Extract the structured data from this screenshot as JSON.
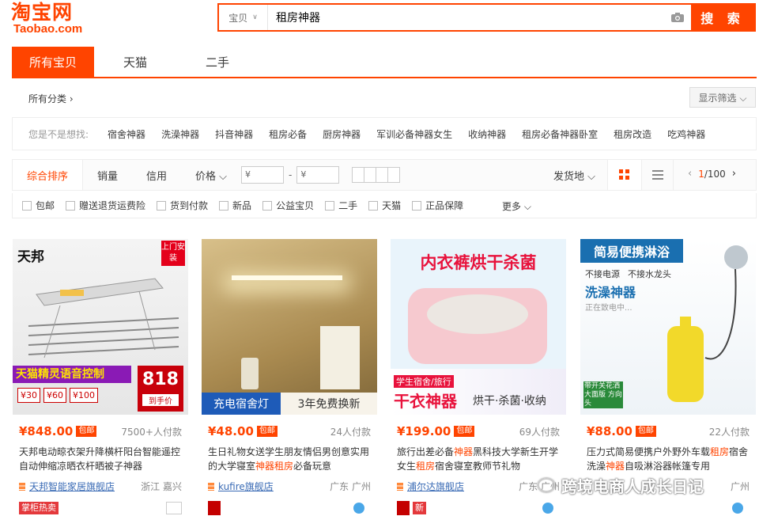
{
  "header": {
    "logo_cn": "淘宝网",
    "logo_en": "Taobao.com",
    "search_category": "宝贝",
    "search_query": "租房神器",
    "search_button": "搜 索"
  },
  "tabs": [
    "所有宝贝",
    "天猫",
    "二手"
  ],
  "all_categories": "所有分类 ›",
  "filter_button": "显示筛选 ⌵",
  "suggestions": {
    "label": "您是不是想找:",
    "items": [
      "宿舍神器",
      "洗澡神器",
      "抖音神器",
      "租房必备",
      "厨房神器",
      "军训必备神器女生",
      "收纳神器",
      "租房必备神器卧室",
      "租房改造",
      "吃鸡神器"
    ]
  },
  "sortbar": {
    "sorts": [
      "综合排序",
      "销量",
      "信用",
      "价格 ⌵"
    ],
    "price_min_placeholder": "¥",
    "price_max_placeholder": "¥",
    "price_dash": "-",
    "ship_from": "发货地 ⌵",
    "page_current": "1",
    "page_total": "/100"
  },
  "checks": [
    "包邮",
    "赠送退货运费险",
    "货到付款",
    "新品",
    "公益宝贝",
    "二手",
    "天猫",
    "正品保障"
  ],
  "more": "更多 ⌵",
  "items": [
    {
      "price": "¥848.00",
      "tag": "包邮",
      "deals": "7500+人付款",
      "title": "天邦电动晾衣架升降横杆阳台智能遥控自动伸缩凉晒衣杆晒被子神器",
      "shop": "天邦智能家居旗舰店",
      "location": "浙江 嘉兴",
      "badge": "掌柜热卖",
      "img_brand": "天邦",
      "img_corner": "上门安装",
      "img_banner": "天猫精灵语音控制",
      "img_num": "818",
      "img_num_sub": "到手价",
      "img_prices": [
        "¥30",
        "¥60",
        "¥100"
      ]
    },
    {
      "price": "¥48.00",
      "tag": "包邮",
      "deals": "24人付款",
      "title_pre": "生日礼物女送学生朋友情侣男创意实用的大学寝室",
      "title_hl1": "神器",
      "title_hl2": "租房",
      "title_post": "必备玩意",
      "shop": "kufire旗舰店",
      "location": "广东 广州",
      "img_left": "充电宿舍灯",
      "img_right": "3年免费换新"
    },
    {
      "price": "¥199.00",
      "tag": "包邮",
      "deals": "69人付款",
      "title_pre": "旅行出差必备",
      "title_hl1": "神器",
      "title_mid": "黑科技大学新生开学女生",
      "title_hl2": "租房",
      "title_post": "宿舍寝室教师节礼物",
      "shop": "浦尔达旗舰店",
      "location": "广东 广州",
      "badge": "新",
      "img_top": "内衣裤烘干杀菌",
      "img_sub": "学生宿舍/旅行",
      "img_big": "干衣神器",
      "img_right": "烘干·杀菌·收纳"
    },
    {
      "price": "¥88.00",
      "tag": "包邮",
      "deals": "22人付款",
      "title_pre": "压力式简易便携户外野外车载",
      "title_hl1": "租房",
      "title_mid": "宿舍洗澡",
      "title_hl2": "神器",
      "title_post": "自吸淋浴器帐篷专用",
      "shop": "",
      "location": "广州",
      "img_top": "简易便携淋浴",
      "img_l1": "不接电源",
      "img_l2": "不接水龙头",
      "img_big": "洗澡神器",
      "img_sub": "正在致电中...",
      "img_tag": "带开关花洒 大面版 方向头"
    }
  ],
  "watermark": "跨境电商人成长日记",
  "colors": {
    "accent": "#ff4400",
    "link": "#3a6bb5"
  }
}
